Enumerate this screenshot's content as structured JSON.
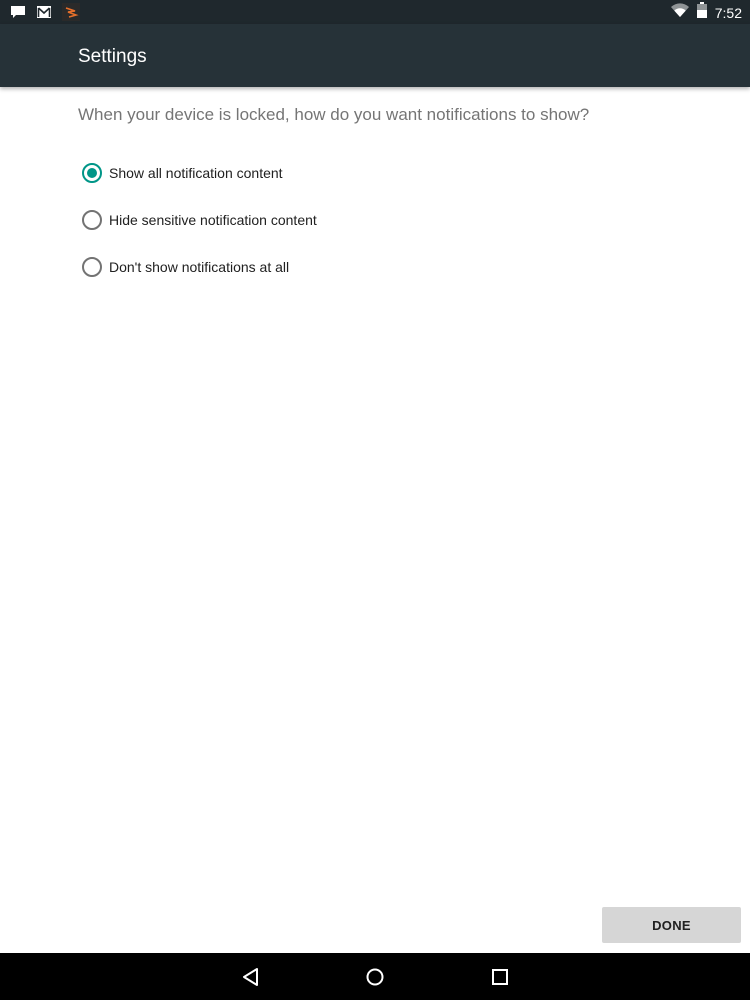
{
  "status_bar": {
    "time": "7:52",
    "left_icons": [
      "chat-notification-icon",
      "gmail-icon",
      "app-notification-icon"
    ],
    "right_icons": [
      "wifi-icon",
      "battery-icon"
    ]
  },
  "app_bar": {
    "title": "Settings"
  },
  "main": {
    "question": "When your device is locked, how do you want notifications to show?",
    "options": [
      {
        "label": "Show all notification content",
        "selected": true
      },
      {
        "label": "Hide sensitive notification content",
        "selected": false
      },
      {
        "label": "Don't show notifications at all",
        "selected": false
      }
    ],
    "done_label": "DONE"
  },
  "nav_bar": {
    "buttons": [
      "back",
      "home",
      "recents"
    ]
  },
  "colors": {
    "accent": "#009688",
    "app_bar": "#263238",
    "status_bar": "#1f282d"
  }
}
